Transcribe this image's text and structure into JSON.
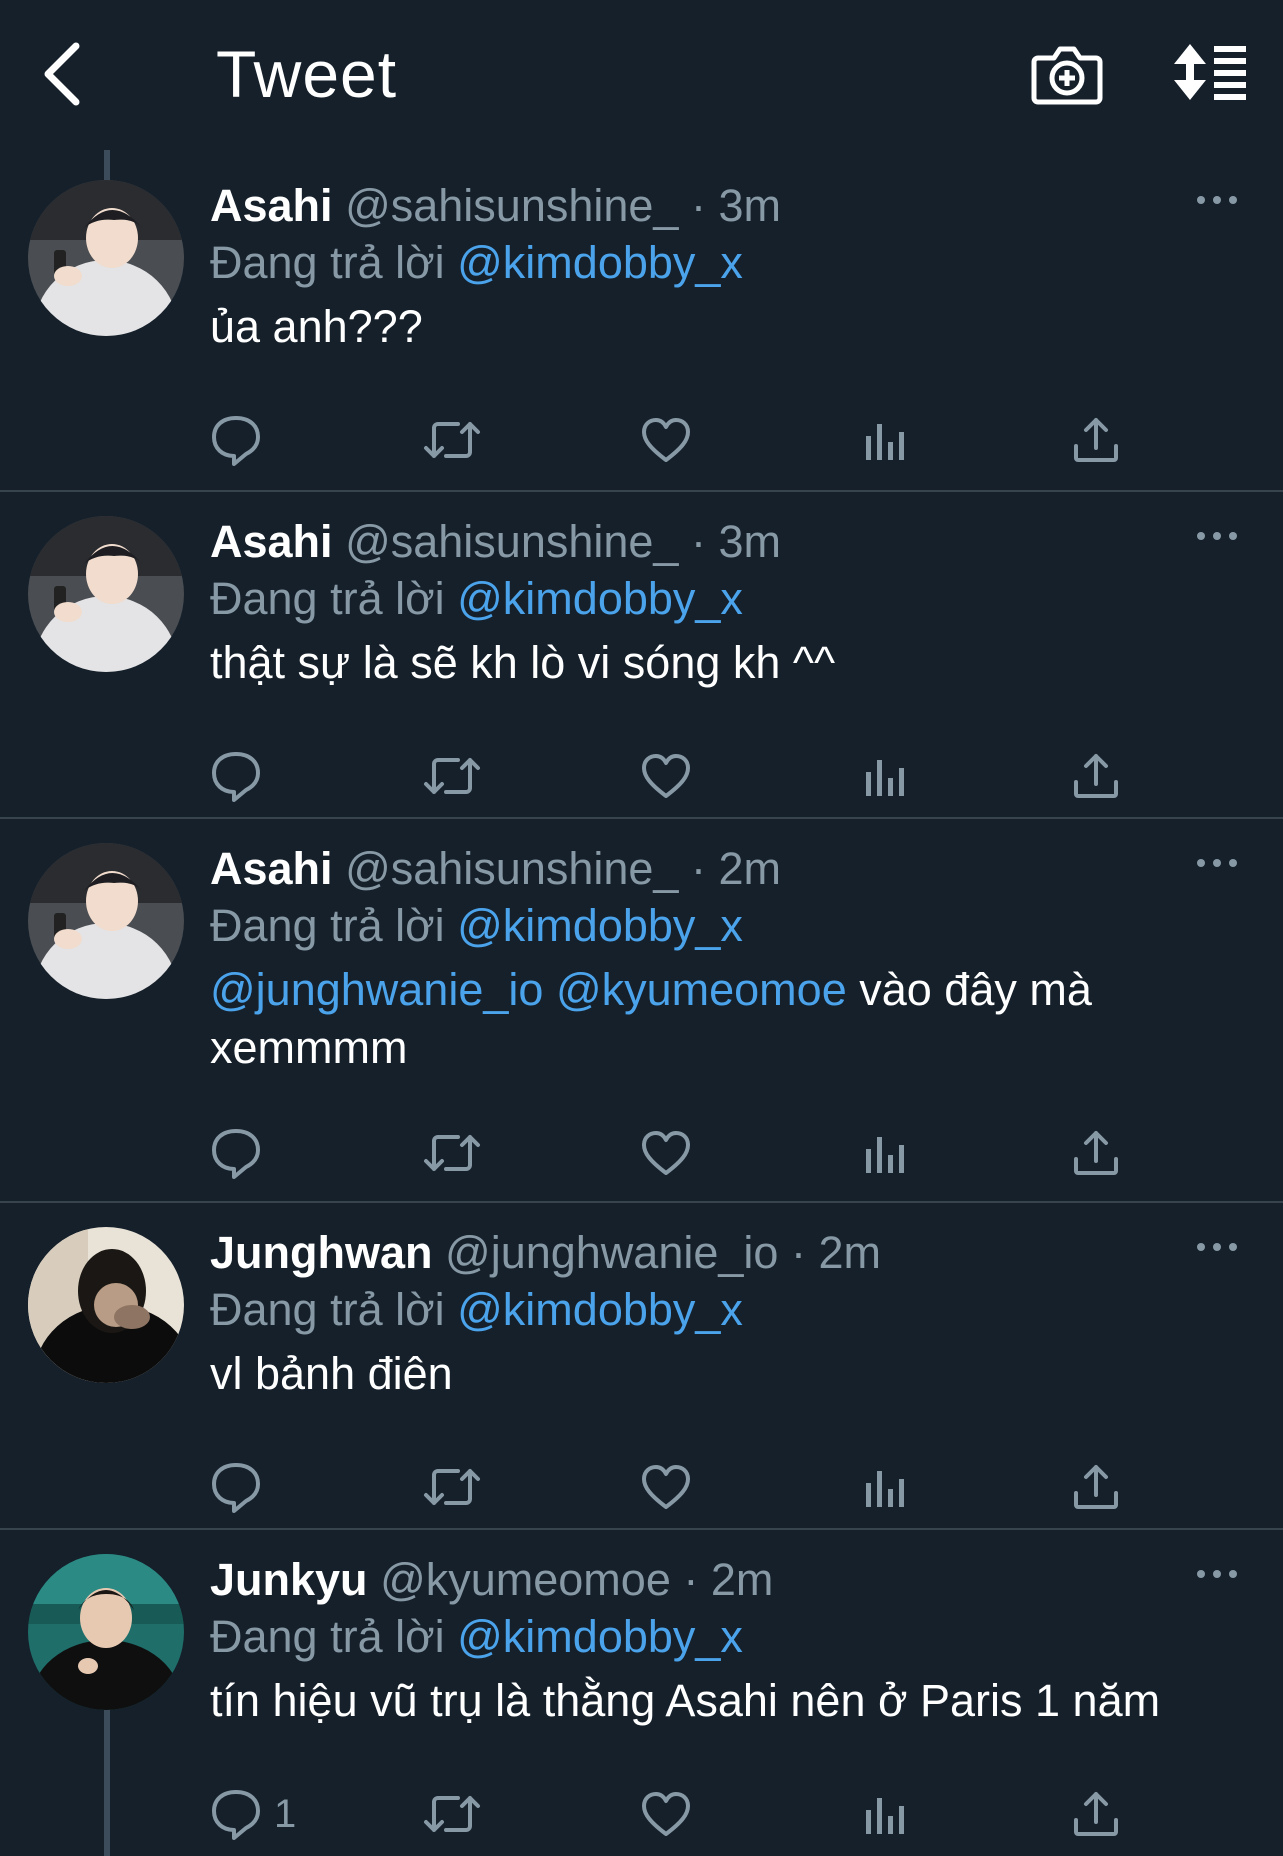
{
  "header": {
    "title": "Tweet",
    "back_icon": "chevron-left-icon",
    "camera_icon": "camera-plus-icon",
    "sort_icon": "sort-list-icon"
  },
  "colors": {
    "background": "#15202b",
    "divider": "#38444d",
    "secondary_text": "#8899a6",
    "link": "#4ba3eb",
    "primary_text": "#ffffff"
  },
  "tweets": [
    {
      "name": "Asahi",
      "handle": "@sahisunshine_",
      "dot": "·",
      "time": "3m",
      "reply_prefix": "Đang trả lời",
      "reply_to": "@kimdobby_x",
      "text": "ủa anh???",
      "reply_count": ""
    },
    {
      "name": "Asahi",
      "handle": "@sahisunshine_",
      "dot": "·",
      "time": "3m",
      "reply_prefix": "Đang trả lời",
      "reply_to": "@kimdobby_x",
      "text": "thật sự là sẽ kh lò vi sóng kh ^^",
      "reply_count": ""
    },
    {
      "name": "Asahi",
      "handle": "@sahisunshine_",
      "dot": "·",
      "time": "2m",
      "reply_prefix": "Đang trả lời",
      "reply_to": "@kimdobby_x",
      "text_mention_1": "@junghwanie_io",
      "text_mention_2": "@kyumeomoe",
      "text": "vào đây mà xemmmm",
      "reply_count": ""
    },
    {
      "name": "Junghwan",
      "handle": "@junghwanie_io",
      "dot": "·",
      "time": "2m",
      "reply_prefix": "Đang trả lời",
      "reply_to": "@kimdobby_x",
      "text": "vl bảnh điên",
      "reply_count": ""
    },
    {
      "name": "Junkyu",
      "handle": "@kyumeomoe",
      "dot": "·",
      "time": "2m",
      "reply_prefix": "Đang trả lời",
      "reply_to": "@kimdobby_x",
      "text": "tín hiệu vũ trụ là thằng Asahi nên ở Paris 1 năm",
      "reply_count": "1"
    }
  ],
  "action_icons": [
    "reply-icon",
    "retweet-icon",
    "like-icon",
    "analytics-icon",
    "share-icon"
  ]
}
